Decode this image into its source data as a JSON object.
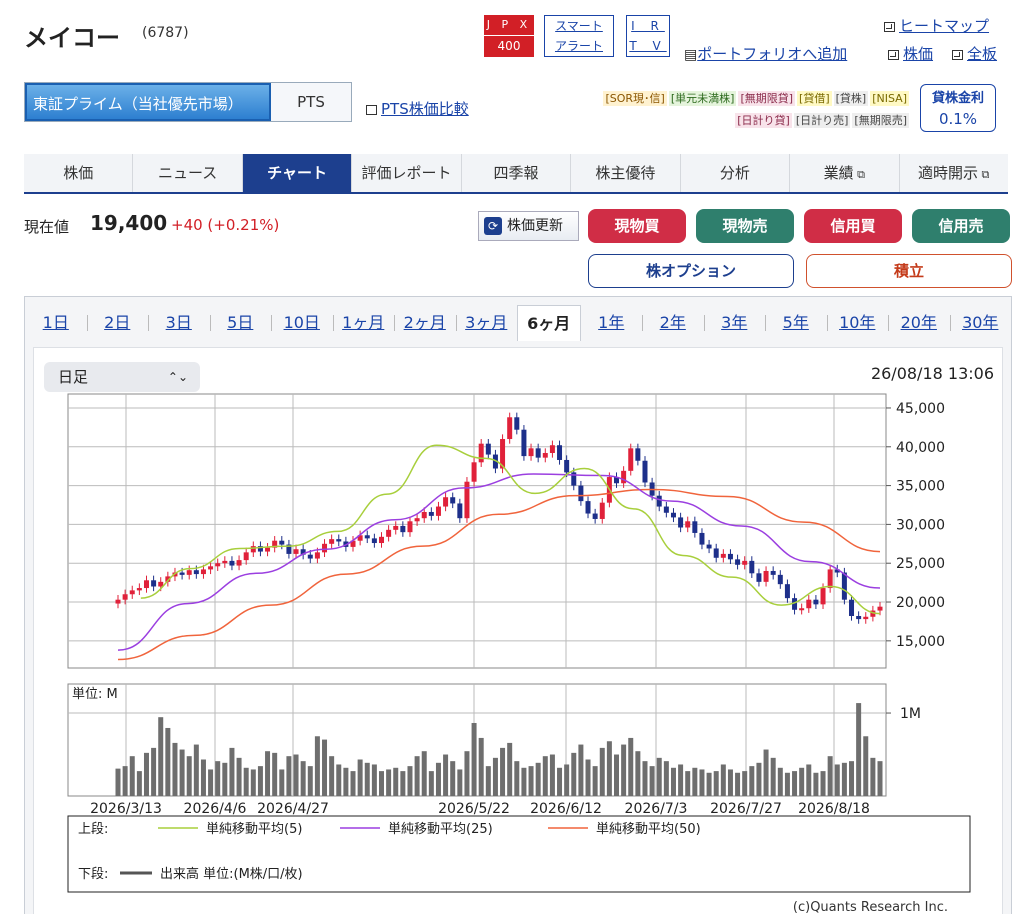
{
  "header": {
    "title": "メイコー",
    "code": "(6787)",
    "jpx": [
      "J P X",
      "400"
    ],
    "smart": [
      "スマート",
      "アラート"
    ],
    "irtv": [
      "I R",
      "T V"
    ],
    "links": {
      "heatmap": "ヒートマップ",
      "portfolio": "ポートフォリオへ追加",
      "price": "株価",
      "board": "全板"
    }
  },
  "market": {
    "primary": "東証プライム（当社優先市場）",
    "pts": "PTS",
    "pts_compare": "PTS株価比較"
  },
  "tags": {
    "row1": [
      "[SOR現･信]",
      "[単元未満株]",
      "[無期限貸]",
      "[貸借]",
      "[貸株]",
      "[NISA]"
    ],
    "row2": [
      "[日計り貸]",
      "[日計り売]",
      "[無期限売]"
    ]
  },
  "lending": {
    "label": "貸株金利",
    "value": "0.1%"
  },
  "nav": [
    "株価",
    "ニュース",
    "チャート",
    "評価レポート",
    "四季報",
    "株主優待",
    "分析",
    "業績",
    "適時開示"
  ],
  "quote": {
    "label": "現在値",
    "price": "19,400",
    "change": "+40 (+0.21%)"
  },
  "buttons": {
    "refresh": "株価更新",
    "cash_buy": "現物買",
    "cash_sell": "現物売",
    "margin_buy": "信用買",
    "margin_sell": "信用売",
    "option": "株オプション",
    "accumulate": "積立"
  },
  "periods": [
    "1日",
    "2日",
    "3日",
    "5日",
    "10日",
    "1ヶ月",
    "2ヶ月",
    "3ヶ月",
    "6ヶ月",
    "1年",
    "2年",
    "3年",
    "5年",
    "10年",
    "20年",
    "30年"
  ],
  "chart_controls": {
    "interval": "日足",
    "timestamp": "26/08/18 13:06"
  },
  "colors": {
    "up": "#e0213a",
    "down": "#1d2f8a",
    "ma5": "#a8cf3c",
    "ma25": "#9b3fe0",
    "ma50": "#f0643c",
    "volume": "#6e6e6e"
  },
  "chart_data": {
    "type": "candlestick+volume",
    "xticks": [
      "2026/3/13",
      "2026/4/6",
      "2026/4/27",
      "2026/5/22",
      "2026/6/12",
      "2026/7/3",
      "2026/7/27",
      "2026/8/18"
    ],
    "price_axis": {
      "ticks": [
        "45,000",
        "40,000",
        "35,000",
        "30,000",
        "25,000",
        "20,000",
        "15,000"
      ],
      "ylim": [
        11500,
        46800
      ]
    },
    "volume_axis": {
      "unit_label": "単位: M",
      "ticks": [
        "1M"
      ],
      "ylim": [
        0,
        1.35
      ]
    },
    "close": [
      20300,
      21000,
      21500,
      21800,
      22800,
      22000,
      22600,
      23300,
      23800,
      23500,
      24100,
      23600,
      24200,
      24600,
      25000,
      25300,
      24700,
      25400,
      26400,
      27200,
      26500,
      27000,
      27900,
      27400,
      26200,
      26800,
      26100,
      25600,
      26400,
      27500,
      28100,
      27800,
      27100,
      27900,
      28600,
      28200,
      27600,
      28400,
      29300,
      29800,
      29000,
      30400,
      30800,
      31600,
      31100,
      32300,
      33500,
      32700,
      30800,
      35500,
      38000,
      40400,
      39000,
      37200,
      41000,
      43800,
      42200,
      38800,
      39800,
      38600,
      39200,
      40200,
      38300,
      36700,
      35000,
      33000,
      31400,
      30700,
      32800,
      36100,
      35300,
      36900,
      39800,
      38200,
      35400,
      33700,
      32300,
      31500,
      30900,
      29600,
      30400,
      28900,
      27400,
      26900,
      25700,
      26200,
      25500,
      24800,
      25300,
      23700,
      22600,
      24000,
      23500,
      22300,
      20500,
      19000,
      19200,
      20300,
      19700,
      21800,
      24200,
      23800,
      20300,
      18200,
      17800,
      18100,
      18900,
      19400
    ],
    "ma": [
      {
        "name": "単純移動平均(5)",
        "sample": [
          20500,
          24300,
          26900,
          27200,
          29100,
          33900,
          40200,
          38500,
          34000,
          37200,
          32000,
          26000,
          23200,
          19600,
          22000,
          18500
        ]
      },
      {
        "name": "単純移動平均(25)",
        "sample": [
          13800,
          19800,
          23700,
          26800,
          30600,
          34700,
          36500,
          36300,
          33000,
          29800,
          25200,
          21800
        ]
      },
      {
        "name": "単純移動平均(50)",
        "sample": [
          12600,
          15700,
          19600,
          23600,
          27200,
          31300,
          33700,
          34500,
          33600,
          30300,
          26500
        ]
      }
    ],
    "volume": [
      0.33,
      0.36,
      0.48,
      0.3,
      0.52,
      0.58,
      0.95,
      0.82,
      0.64,
      0.56,
      0.48,
      0.62,
      0.44,
      0.32,
      0.42,
      0.4,
      0.58,
      0.46,
      0.34,
      0.32,
      0.36,
      0.54,
      0.52,
      0.32,
      0.48,
      0.5,
      0.42,
      0.36,
      0.72,
      0.68,
      0.48,
      0.38,
      0.34,
      0.3,
      0.44,
      0.4,
      0.38,
      0.3,
      0.32,
      0.34,
      0.3,
      0.36,
      0.48,
      0.54,
      0.3,
      0.4,
      0.5,
      0.42,
      0.32,
      0.54,
      0.88,
      0.7,
      0.36,
      0.46,
      0.58,
      0.64,
      0.42,
      0.34,
      0.36,
      0.4,
      0.48,
      0.5,
      0.34,
      0.38,
      0.52,
      0.62,
      0.44,
      0.36,
      0.58,
      0.66,
      0.5,
      0.62,
      0.7,
      0.54,
      0.42,
      0.36,
      0.46,
      0.42,
      0.34,
      0.38,
      0.3,
      0.34,
      0.32,
      0.28,
      0.3,
      0.38,
      0.32,
      0.28,
      0.3,
      0.36,
      0.4,
      0.56,
      0.46,
      0.34,
      0.28,
      0.3,
      0.34,
      0.38,
      0.28,
      0.3,
      0.48,
      0.38,
      0.4,
      0.42,
      1.12,
      0.72,
      0.46,
      0.42
    ],
    "legend": {
      "upper_label": "上段:",
      "lower_label": "下段:",
      "lower_item": "出来高 単位:(M株/口/枚)"
    },
    "credit": "(c)Quants Research Inc."
  }
}
